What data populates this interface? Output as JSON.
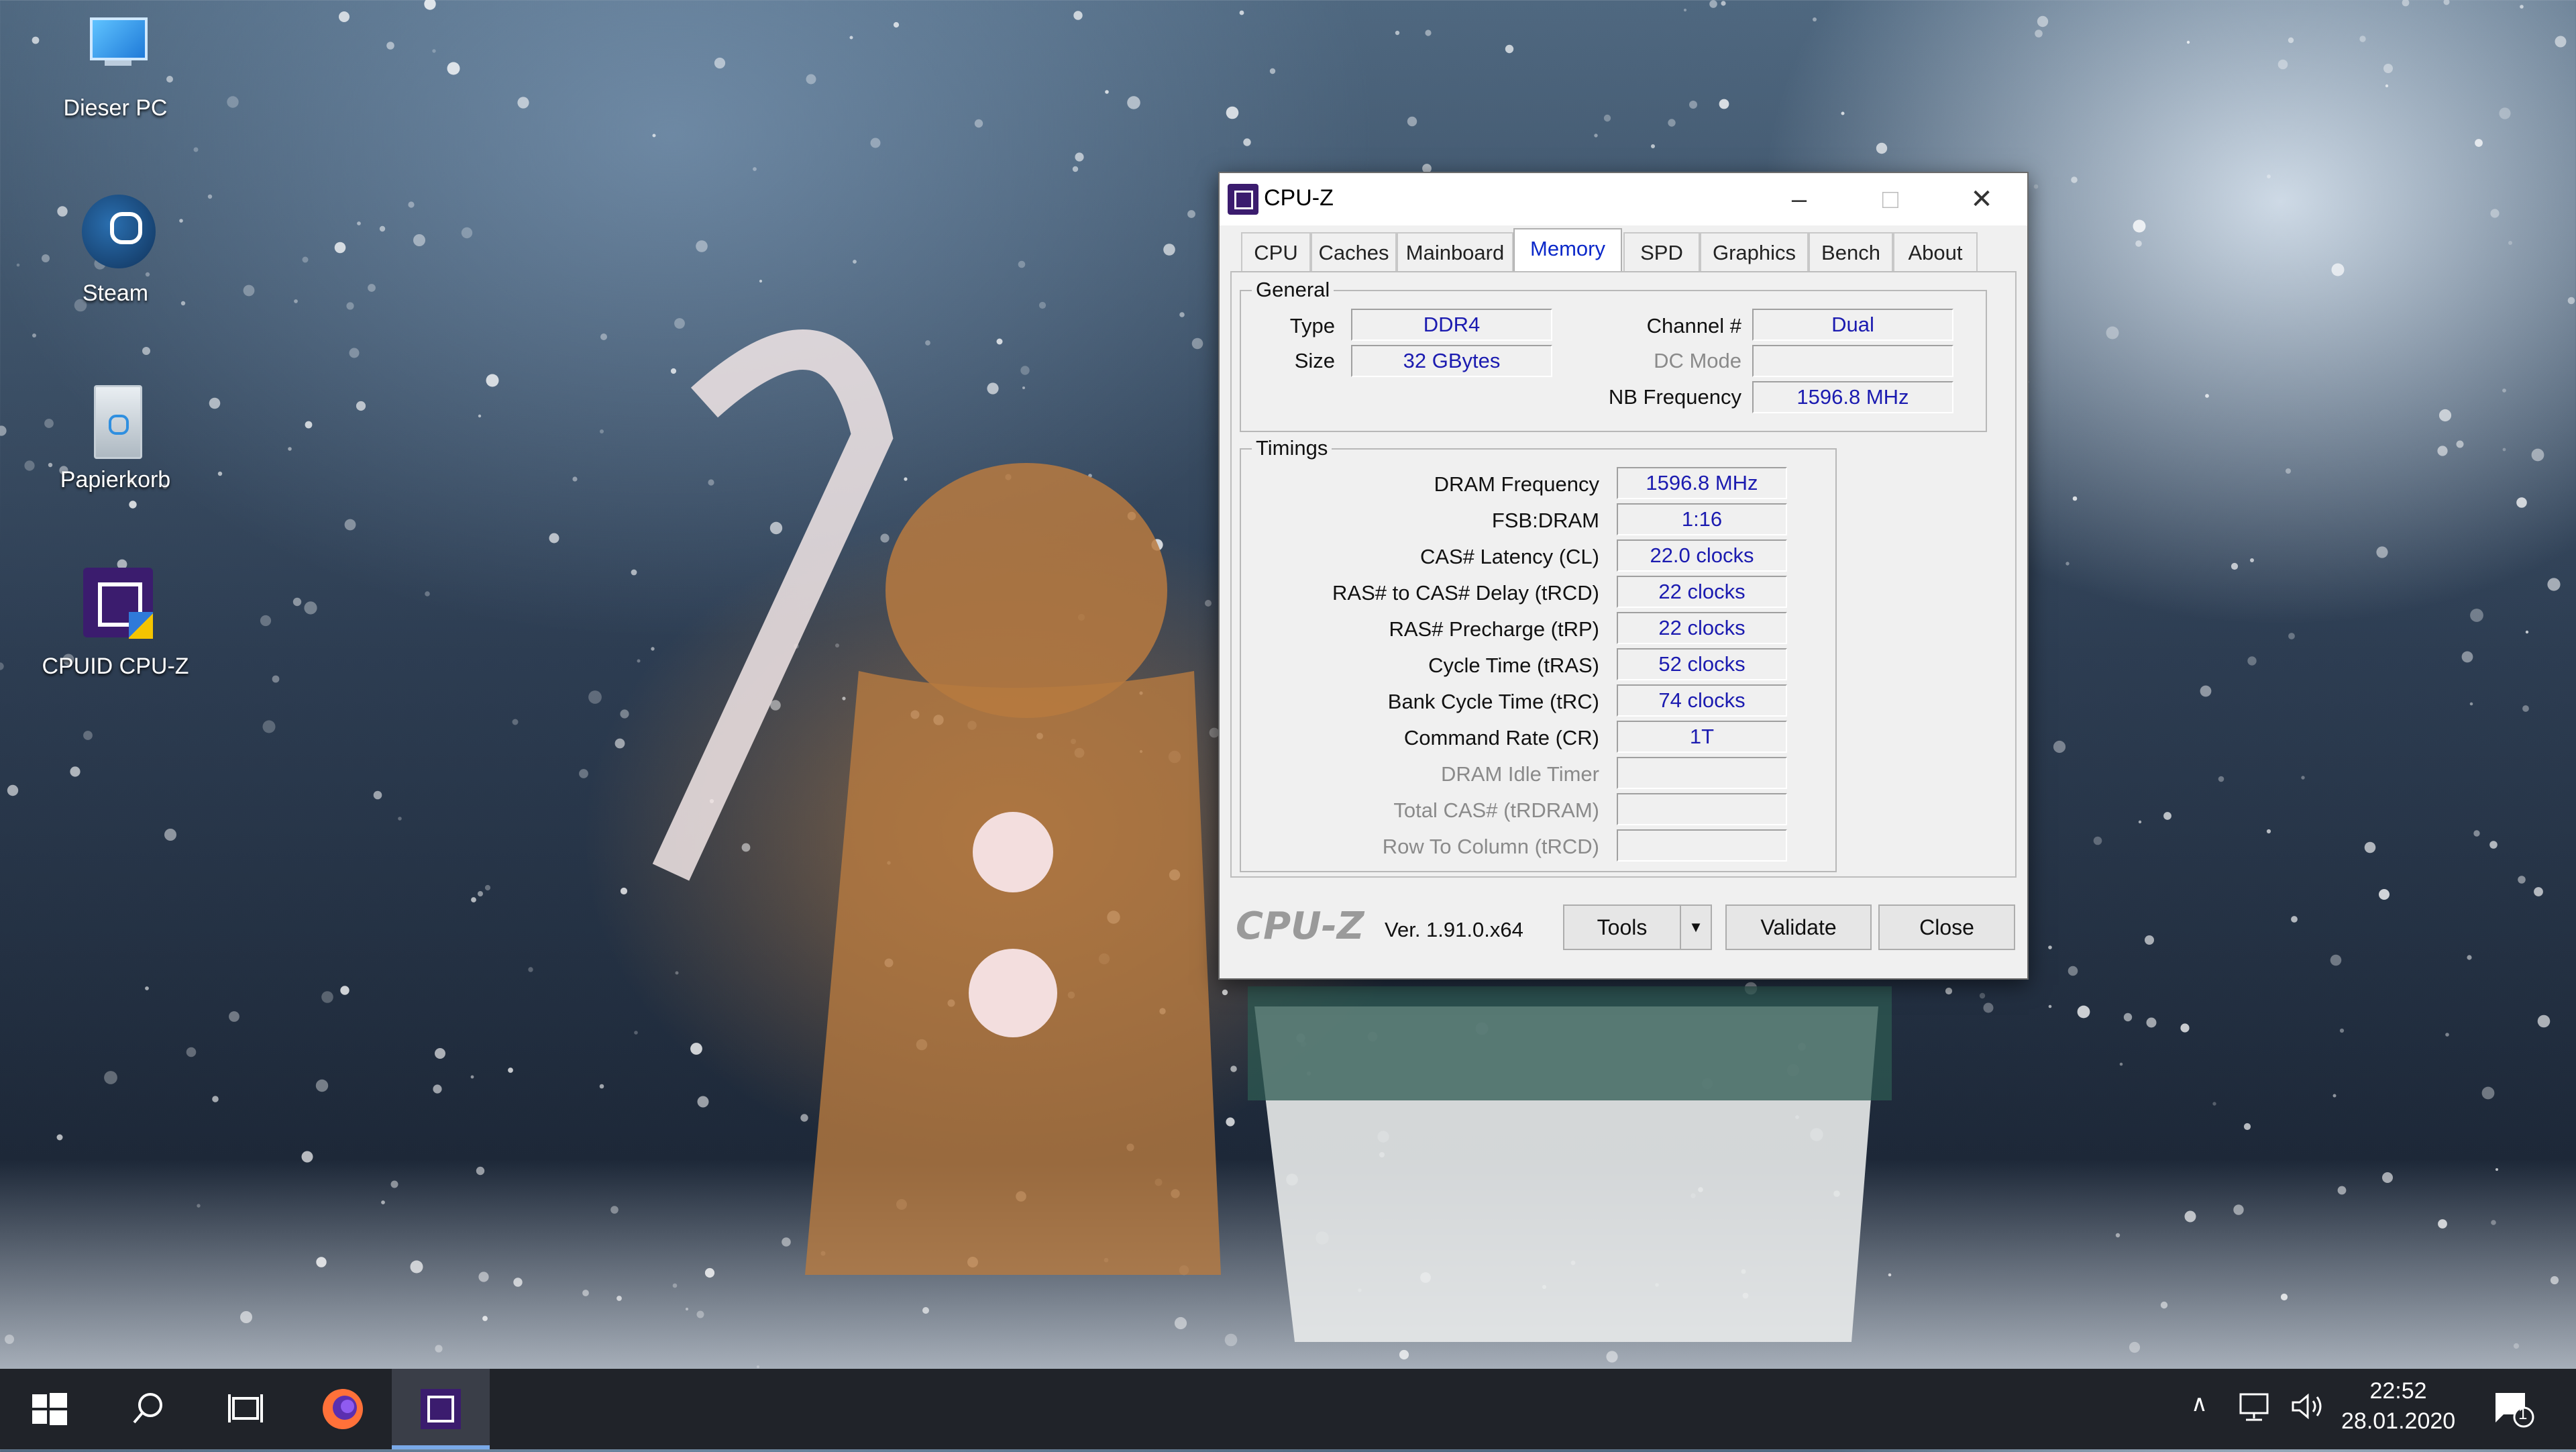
{
  "desktop": {
    "icons": [
      {
        "label": "Dieser PC"
      },
      {
        "label": "Steam"
      },
      {
        "label": "Papierkorb"
      },
      {
        "label": "CPUID CPU-Z"
      }
    ]
  },
  "window": {
    "title": "CPU-Z",
    "minimize": "–",
    "maximize": "□",
    "close": "✕",
    "tabs": [
      "CPU",
      "Caches",
      "Mainboard",
      "Memory",
      "SPD",
      "Graphics",
      "Bench",
      "About"
    ],
    "active_tab": "Memory",
    "general": {
      "label": "General",
      "type_label": "Type",
      "type_value": "DDR4",
      "size_label": "Size",
      "size_value": "32 GBytes",
      "channel_label": "Channel #",
      "channel_value": "Dual",
      "dcmode_label": "DC Mode",
      "dcmode_value": "",
      "nbfreq_label": "NB Frequency",
      "nbfreq_value": "1596.8 MHz"
    },
    "timings": {
      "label": "Timings",
      "rows": [
        {
          "label": "DRAM Frequency",
          "value": "1596.8 MHz"
        },
        {
          "label": "FSB:DRAM",
          "value": "1:16"
        },
        {
          "label": "CAS# Latency (CL)",
          "value": "22.0 clocks"
        },
        {
          "label": "RAS# to CAS# Delay (tRCD)",
          "value": "22 clocks"
        },
        {
          "label": "RAS# Precharge (tRP)",
          "value": "22 clocks"
        },
        {
          "label": "Cycle Time (tRAS)",
          "value": "52 clocks"
        },
        {
          "label": "Bank Cycle Time (tRC)",
          "value": "74 clocks"
        },
        {
          "label": "Command Rate (CR)",
          "value": "1T"
        },
        {
          "label": "DRAM Idle Timer",
          "value": ""
        },
        {
          "label": "Total CAS# (tRDRAM)",
          "value": ""
        },
        {
          "label": "Row To Column (tRCD)",
          "value": ""
        }
      ]
    },
    "footer": {
      "logo": "CPU-Z",
      "version": "Ver. 1.91.0.x64",
      "tools": "Tools",
      "dropdown": "▼",
      "validate": "Validate",
      "close": "Close"
    }
  },
  "taskbar": {
    "time": "22:52",
    "date": "28.01.2020",
    "notification_count": "1",
    "chevron": "∧"
  },
  "colors": {
    "value_text": "#1b1bb0",
    "active_tab": "#0b28c9",
    "taskbar": "#202329"
  }
}
